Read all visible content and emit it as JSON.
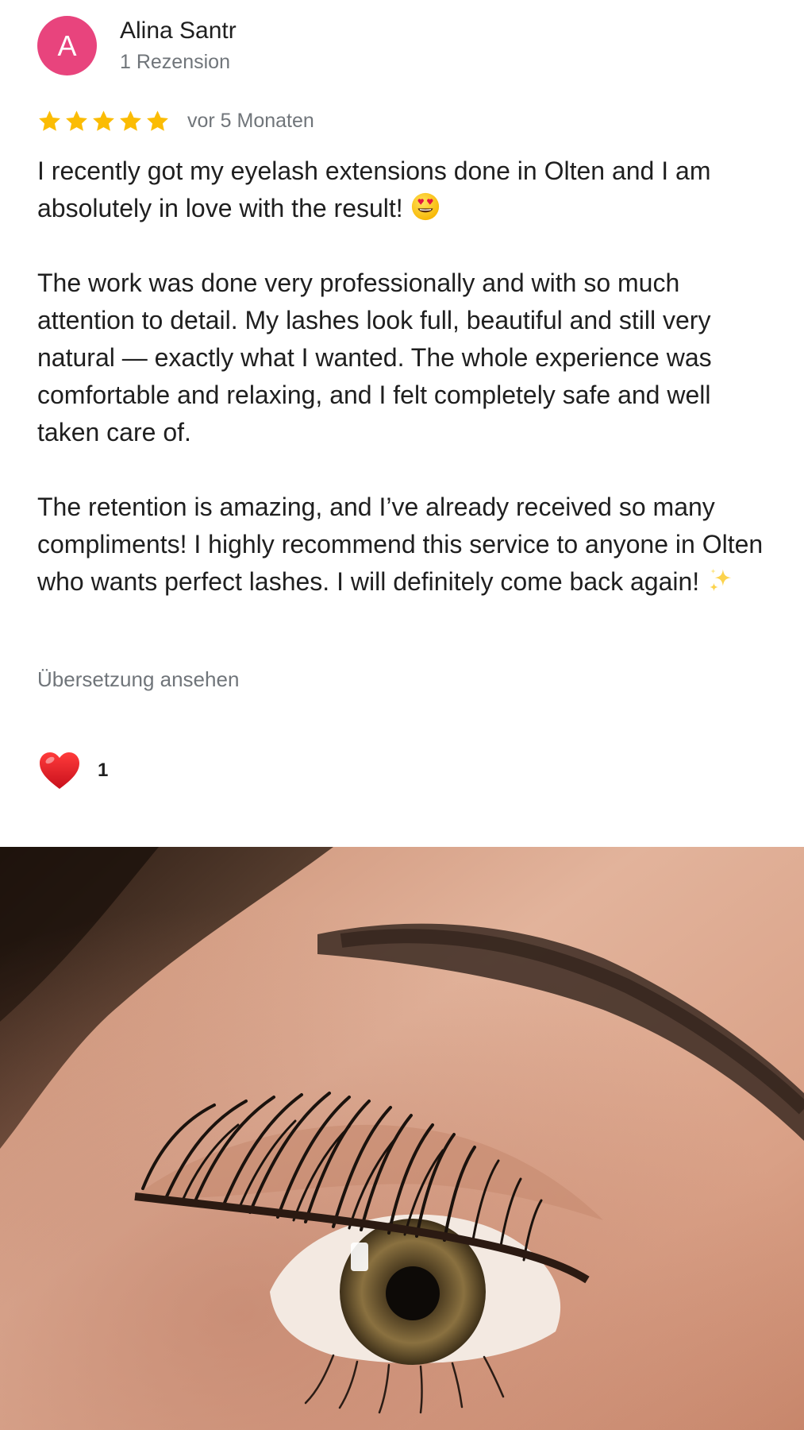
{
  "review": {
    "author": {
      "initial": "A",
      "name": "Alina Santr",
      "review_count": "1 Rezension",
      "avatar_color": "#e8447d"
    },
    "rating": {
      "stars": 5,
      "max_stars": 5,
      "star_color": "#fbbc04"
    },
    "date": "vor 5 Monaten",
    "paragraphs": {
      "p1": "I recently got my eyelash extensions done in Olten and I am absolutely in love with the result!",
      "p2": "The work was done very professionally and with so much attention to detail. My lashes look full, beautiful and still very natural — exactly what I wanted. The whole experience was comfortable and relaxing, and I felt completely safe and well taken care of.",
      "p3": "The retention is amazing, and I’ve already received so many compliments! I highly recommend this service to anyone in Olten who wants perfect lashes. I will definitely come back again!"
    },
    "emojis": {
      "p1_end": "heart-eyes-emoji",
      "p3_end": "sparkles-emoji"
    },
    "translate_link": "Übersetzung ansehen",
    "reaction": {
      "icon": "heart-icon",
      "count": "1"
    }
  },
  "photo": {
    "subject": "eyelash-extension-photo"
  }
}
